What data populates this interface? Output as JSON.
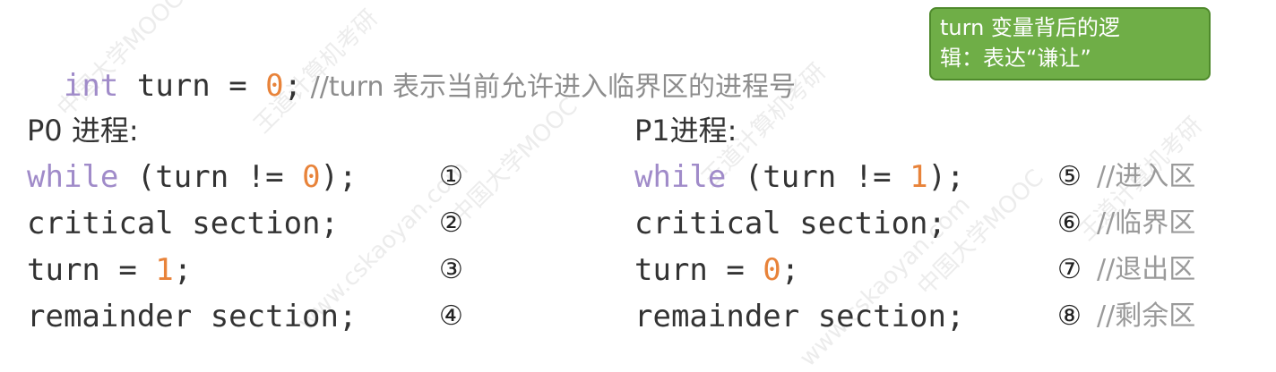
{
  "watermark": [
    "中国大学MOOC",
    "王道计算机考研",
    "www.cskaoyan.com"
  ],
  "header": {
    "type_kw": "int",
    "decl": " turn = ",
    "zero": "0",
    "semi": ";",
    "comment": " //turn 表示当前允许进入临界区的进程号"
  },
  "callout": {
    "line1": "turn 变量背后的逻",
    "line2": "辑：表达“谦让”"
  },
  "p0": {
    "title": "P0 进程:",
    "line1_kw": "while",
    "line1_rest_a": " (turn != ",
    "line1_num": "0",
    "line1_rest_b": ");",
    "line2": "critical section;",
    "line3_a": "turn = ",
    "line3_num": "1",
    "line3_b": ";",
    "line4": "remainder section;",
    "markers": [
      "①",
      "②",
      "③",
      "④"
    ]
  },
  "p1": {
    "title": "P1进程:",
    "line1_kw": "while",
    "line1_rest_a": " (turn != ",
    "line1_num": "1",
    "line1_rest_b": ");",
    "line2": "critical section;",
    "line3_a": "turn = ",
    "line3_num": "0",
    "line3_b": ";",
    "line4": "remainder section;",
    "markers": [
      "⑤",
      "⑥",
      "⑦",
      "⑧"
    ],
    "comments": [
      "//进入区",
      "//临界区",
      "//退出区",
      "//剩余区"
    ]
  },
  "colors": {
    "keyword": "#a08bc9",
    "number": "#e8833a",
    "comment": "#8d8d8d",
    "callout_bg": "#6fae47"
  }
}
